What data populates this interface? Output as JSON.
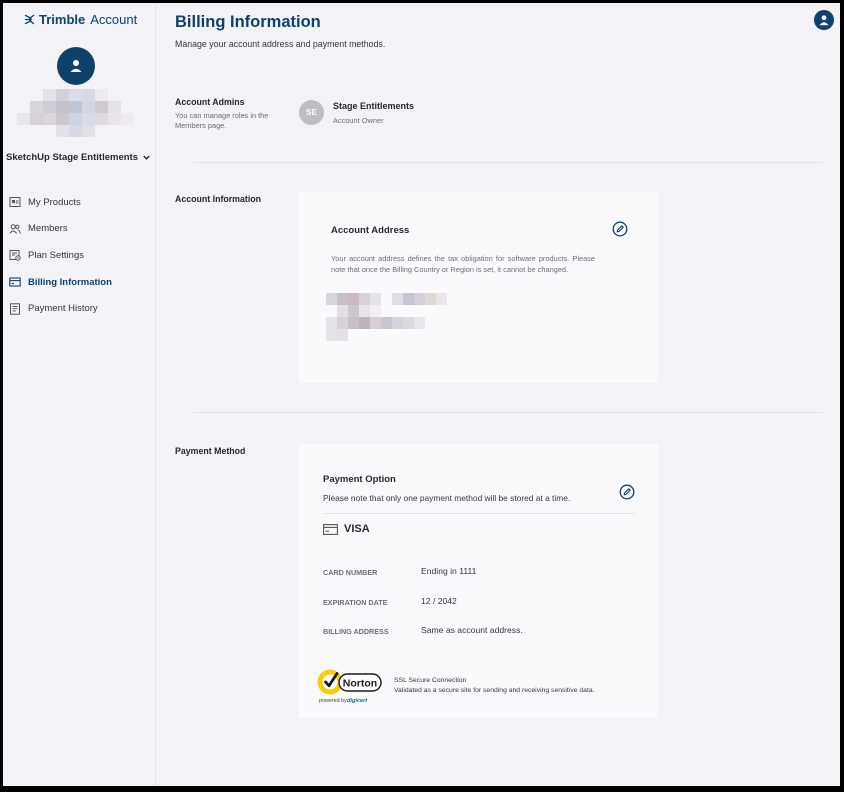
{
  "brand": {
    "name_bold": "Trimble",
    "name_light": "Account"
  },
  "sidebar": {
    "account_name": "SketchUp Stage Entitlements",
    "items": [
      {
        "label": "My Products",
        "icon": "products-icon",
        "active": false
      },
      {
        "label": "Members",
        "icon": "members-icon",
        "active": false
      },
      {
        "label": "Plan Settings",
        "icon": "plan-settings-icon",
        "active": false
      },
      {
        "label": "Billing Information",
        "icon": "billing-icon",
        "active": true
      },
      {
        "label": "Payment History",
        "icon": "payment-history-icon",
        "active": false
      }
    ]
  },
  "header": {
    "title": "Billing Information",
    "subtitle": "Manage your account address and payment methods."
  },
  "account_admins": {
    "label": "Account Admins",
    "note": "You can manage roles in the Members page.",
    "admin": {
      "initials": "SE",
      "name": "Stage Entitlements",
      "role": "Account Owner"
    }
  },
  "account_information": {
    "label": "Account Information",
    "card_title": "Account Address",
    "description": "Your account address defines the tax obligation for software products. Please note that once the Billing Country or Region is set, it cannot be changed."
  },
  "payment_method": {
    "label": "Payment Method",
    "card_title": "Payment Option",
    "note": "Please note that only one payment method will be stored at a time.",
    "brand": "VISA",
    "rows": [
      {
        "label": "Card Number",
        "value": "Ending in 1111"
      },
      {
        "label": "Expiration Date",
        "value": "12 / 2042"
      },
      {
        "label": "Billing Address",
        "value": "Same as account address."
      }
    ],
    "ssl_title": "SSL Secure Connection",
    "ssl_subtitle": "Validated as a secure site for sending and receiving sensitive data.",
    "norton": {
      "name": "Norton",
      "powered_by": "powered by",
      "digicert": "digicert"
    }
  },
  "colors": {
    "brand_navy": "#0e416c",
    "norton_yellow": "#fdcb0a",
    "page_bg": "#f3f3f7",
    "card_bg": "#fafafc"
  }
}
